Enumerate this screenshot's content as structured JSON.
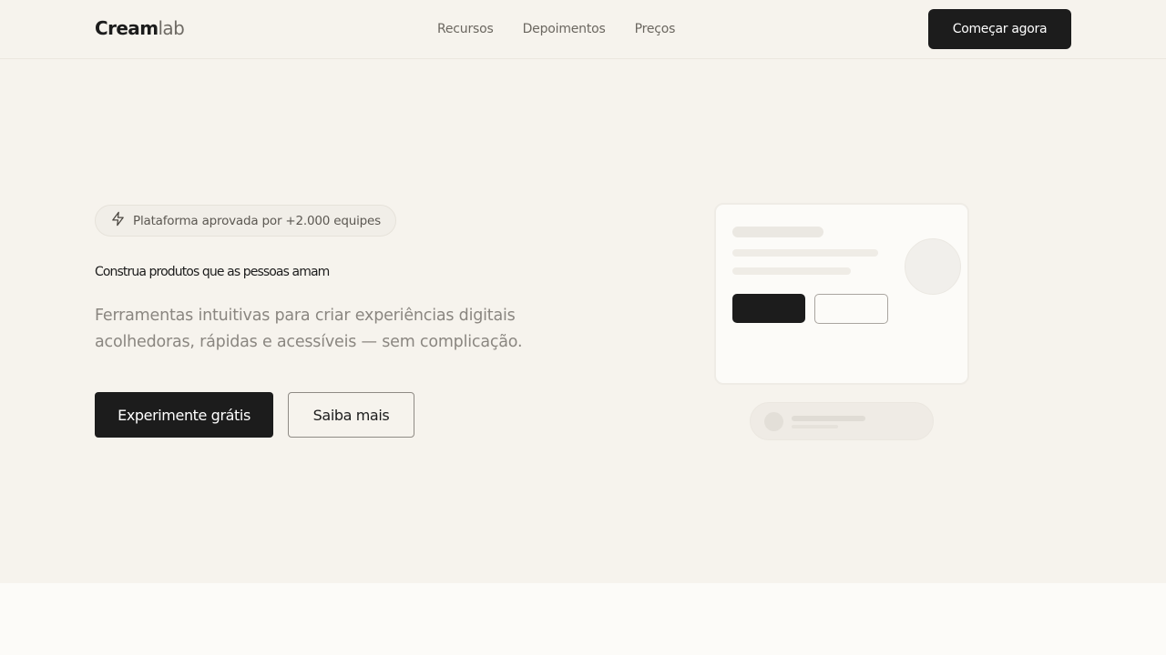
{
  "header": {
    "logo_bold": "Cream",
    "logo_light": "lab",
    "nav": [
      "Recursos",
      "Depoimentos",
      "Preços"
    ],
    "cta_label": "Começar agora"
  },
  "hero": {
    "badge_icon": "lightning-icon",
    "badge_text": "Plataforma aprovada por +2.000 equipes",
    "title": "Construa produtos que as pessoas amam",
    "description": "Ferramentas intuitivas para criar experiências digitais acolhedoras, rápidas e acessíveis — sem complicação.",
    "primary_button": "Experimente grátis",
    "secondary_button": "Saiba mais"
  },
  "colors": {
    "background": "#f6f3ed",
    "surface": "#fcfbf8",
    "primary": "#1c1c1c",
    "muted_text": "#8a8680"
  }
}
